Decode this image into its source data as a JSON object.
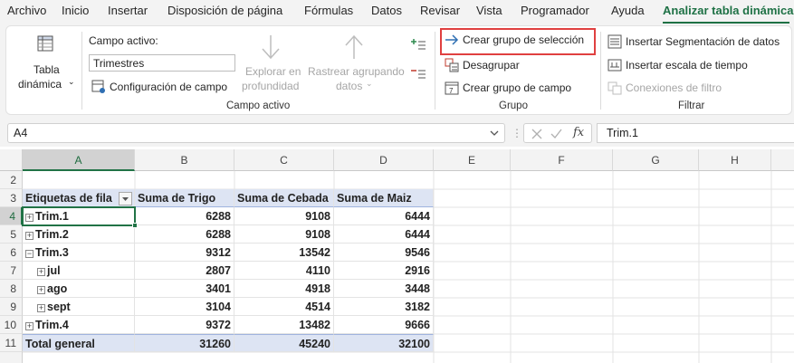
{
  "menu": {
    "tabs": [
      {
        "label": "Archivo"
      },
      {
        "label": "Inicio"
      },
      {
        "label": "Insertar"
      },
      {
        "label": "Disposición de página"
      },
      {
        "label": "Fórmulas"
      },
      {
        "label": "Datos"
      },
      {
        "label": "Revisar"
      },
      {
        "label": "Vista"
      },
      {
        "label": "Programador"
      },
      {
        "label": "Ayuda"
      },
      {
        "label": "Analizar tabla dinámica",
        "active": true
      }
    ]
  },
  "ribbon": {
    "tabla_dinamica": {
      "line1": "Tabla",
      "line2": "dinámica"
    },
    "campo_activo": {
      "label": "Campo activo:",
      "value": "Trimestres",
      "config": "Configuración de campo",
      "explorar": {
        "line1": "Explorar en",
        "line2": "profundidad"
      },
      "rastrear": {
        "line1": "Rastrear agrupando",
        "line2": "datos"
      },
      "group_title": "Campo activo"
    },
    "grupo": {
      "crear_seleccion": "Crear grupo de selección",
      "desagrupar": "Desagrupar",
      "crear_campo": "Crear grupo de campo",
      "group_title": "Grupo"
    },
    "filtrar": {
      "segmentacion": "Insertar Segmentación de datos",
      "escala": "Insertar escala de tiempo",
      "conexiones": "Conexiones de filtro",
      "group_title": "Filtrar"
    }
  },
  "formula_bar": {
    "name_box": "A4",
    "fx": "fx",
    "formula": "Trim.1"
  },
  "sheet": {
    "columns": [
      "A",
      "B",
      "C",
      "D",
      "E",
      "F",
      "G",
      "H"
    ],
    "row_numbers": [
      "2",
      "3",
      "4",
      "5",
      "6",
      "7",
      "8",
      "9",
      "10",
      "11"
    ],
    "header": {
      "a": "Etiquetas de fila",
      "b": "Suma de Trigo",
      "c": "Suma de Cebada",
      "d": "Suma de Maiz"
    },
    "rows": [
      {
        "label": "Trim.1",
        "trigo": "6288",
        "cebada": "9108",
        "maiz": "6444",
        "expander": "+"
      },
      {
        "label": "Trim.2",
        "trigo": "6288",
        "cebada": "9108",
        "maiz": "6444",
        "expander": "+"
      },
      {
        "label": "Trim.3",
        "trigo": "9312",
        "cebada": "13542",
        "maiz": "9546",
        "expander": "−"
      },
      {
        "label": "jul",
        "trigo": "2807",
        "cebada": "4110",
        "maiz": "2916",
        "expander": "+"
      },
      {
        "label": "ago",
        "trigo": "3401",
        "cebada": "4918",
        "maiz": "3448",
        "expander": "+"
      },
      {
        "label": "sept",
        "trigo": "3104",
        "cebada": "4514",
        "maiz": "3182",
        "expander": "+"
      },
      {
        "label": "Trim.4",
        "trigo": "9372",
        "cebada": "13482",
        "maiz": "9666",
        "expander": "+"
      }
    ],
    "total": {
      "label": "Total general",
      "trigo": "31260",
      "cebada": "45240",
      "maiz": "32100"
    }
  },
  "colors": {
    "accent": "#1e7145",
    "highlight_border": "#e04040",
    "pivot_header_fill": "#dde4f3"
  }
}
